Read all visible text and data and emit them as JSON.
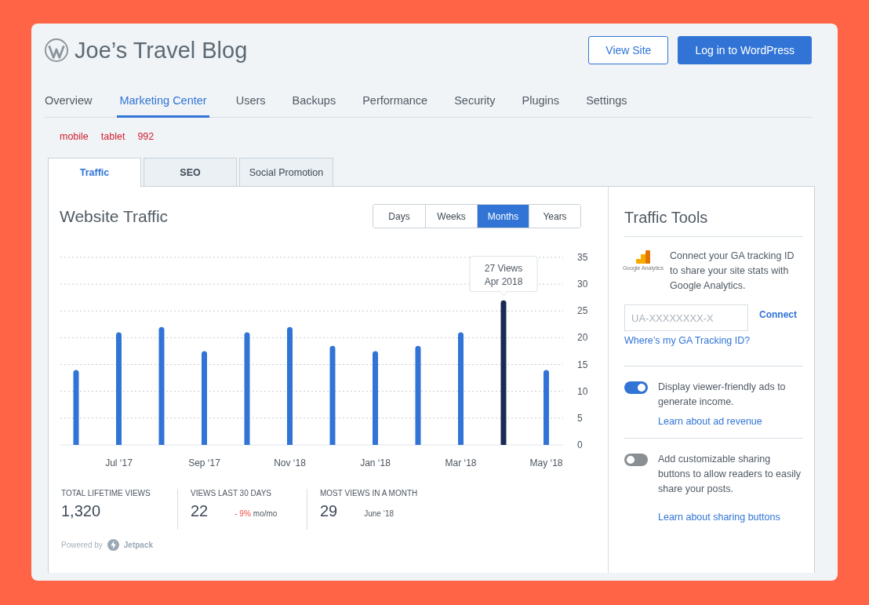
{
  "site": {
    "title": "Joe’s Travel Blog"
  },
  "header_buttons": [
    {
      "label": "View Site",
      "kind": "outline"
    },
    {
      "label": "Log in to WordPress",
      "kind": "primary"
    }
  ],
  "nav": [
    {
      "label": "Overview",
      "selected": false
    },
    {
      "label": "Marketing Center",
      "selected": true
    },
    {
      "label": "Users",
      "selected": false
    },
    {
      "label": "Backups",
      "selected": false
    },
    {
      "label": "Performance",
      "selected": false
    },
    {
      "label": "Security",
      "selected": false
    },
    {
      "label": "Plugins",
      "selected": false
    },
    {
      "label": "Settings",
      "selected": false
    }
  ],
  "debug_labels": [
    "mobile",
    "tablet",
    "992"
  ],
  "tabs": [
    {
      "label": "Traffic",
      "selected": true
    },
    {
      "label": "SEO",
      "selected": false
    },
    {
      "label": "Social Promotion",
      "selected": false
    }
  ],
  "traffic": {
    "title": "Website Traffic",
    "ranges": [
      {
        "label": "Days",
        "selected": false
      },
      {
        "label": "Weeks",
        "selected": false
      },
      {
        "label": "Months",
        "selected": true
      },
      {
        "label": "Years",
        "selected": false
      }
    ],
    "chart_data": {
      "type": "bar",
      "categories": [
        null,
        "Jul ‘17",
        null,
        "Sep ‘17",
        null,
        "Nov ‘18",
        null,
        "Jan ‘18",
        null,
        "Mar ‘18",
        null,
        "May ‘18"
      ],
      "values": [
        14,
        21,
        22,
        17.5,
        21,
        22,
        18.5,
        17.5,
        18.5,
        21,
        27,
        14
      ],
      "ylim": [
        0,
        35
      ],
      "yticks": [
        0,
        5,
        10,
        15,
        20,
        25,
        30,
        35
      ],
      "grid": true
    },
    "bar_states": [
      {
        "selected": false
      },
      {
        "selected": false
      },
      {
        "selected": false
      },
      {
        "selected": false
      },
      {
        "selected": false
      },
      {
        "selected": false
      },
      {
        "selected": false
      },
      {
        "selected": false
      },
      {
        "selected": false
      },
      {
        "selected": false
      },
      {
        "selected": true
      },
      {
        "selected": false
      }
    ],
    "tooltip": {
      "title": "27 Views",
      "subtitle": "Apr 2018"
    },
    "stats": [
      {
        "label": "TOTAL LIFETIME VIEWS",
        "value": "1,320"
      },
      {
        "label": "VIEWS LAST 30 DAYS",
        "value": "22",
        "change": "- 9%",
        "change_unit": "mo/mo"
      },
      {
        "label": "MOST VIEWS IN A MONTH",
        "value": "29",
        "note": "June ‘18"
      }
    ],
    "powered_by": "Powered by",
    "powered_brand": "Jetpack"
  },
  "tools": {
    "title": "Traffic Tools",
    "ga": {
      "logo_caption": "Google Analytics",
      "text": "Connect your GA tracking ID to share your site stats with Google Analytics.",
      "placeholder": "UA-XXXXXXXX-X",
      "connect": "Connect",
      "help_link": "Where’s my GA Tracking ID?"
    },
    "toggles": [
      {
        "on": true,
        "text": "Display viewer-friendly ads to generate income.",
        "link": "Learn about ad revenue"
      },
      {
        "on": false,
        "text": "Add customizable sharing buttons to allow readers to easily share your posts.",
        "link": "Learn about sharing buttons"
      }
    ]
  }
}
